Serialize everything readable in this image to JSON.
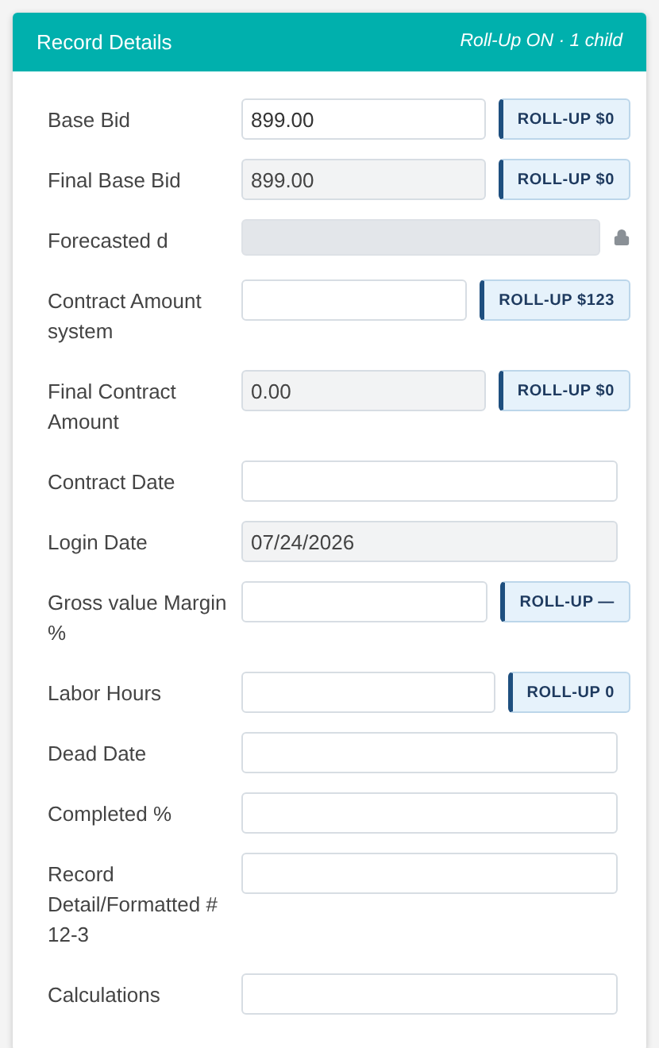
{
  "header": {
    "title": "Record Details",
    "status": "Roll-Up ON · 1 child"
  },
  "fields": [
    {
      "label": "Base Bid",
      "kind": "rollup",
      "value": "899.00",
      "readonly": false,
      "rollup": "ROLL-UP $0"
    },
    {
      "label": "Final Base Bid",
      "kind": "rollup",
      "value": "899.00",
      "readonly": true,
      "rollup": "ROLL-UP $0"
    },
    {
      "label": "Forecasted d",
      "kind": "locked"
    },
    {
      "label": "Contract Amount system",
      "kind": "rollup",
      "readonly": false,
      "rollup": "ROLL-UP $123"
    },
    {
      "label": "Final Contract Amount",
      "kind": "rollup",
      "value": "0.00",
      "readonly": true,
      "rollup": "ROLL-UP $0"
    },
    {
      "label": "Contract Date",
      "kind": "plain",
      "readonly": false
    },
    {
      "label": "Login Date",
      "kind": "plain",
      "value": "07/24/2026",
      "readonly": true
    },
    {
      "label": "Gross value Margin %",
      "kind": "rollup",
      "readonly": false,
      "rollup": "ROLL-UP —"
    },
    {
      "label": "Labor Hours",
      "kind": "rollup",
      "readonly": false,
      "rollup": "ROLL-UP 0"
    },
    {
      "label": "Dead Date",
      "kind": "plain",
      "readonly": false
    },
    {
      "label": "Completed %",
      "kind": "plain",
      "readonly": false
    },
    {
      "label": "Record Detail/Formatted # 12-3",
      "kind": "plain",
      "readonly": false
    },
    {
      "label": "Calculations",
      "kind": "plain",
      "readonly": false
    }
  ]
}
